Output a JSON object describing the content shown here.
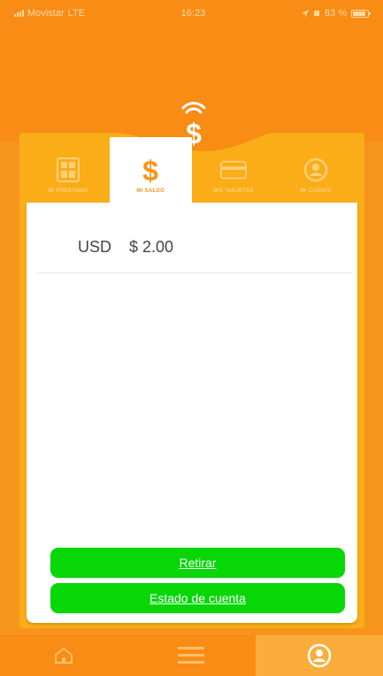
{
  "status_bar": {
    "carrier": "Movistar",
    "network": "LTE",
    "time": "16:23",
    "battery": "83 %"
  },
  "tabs": [
    {
      "label": "MI PRESTAMO",
      "icon": "calculator-icon",
      "active": false
    },
    {
      "label": "MI SALDO",
      "icon": "dollar-icon",
      "active": true
    },
    {
      "label": "MIS TARJETAS",
      "icon": "card-icon",
      "active": false
    },
    {
      "label": "MI CUENTA",
      "icon": "account-icon",
      "active": false
    }
  ],
  "balance": {
    "currency": "USD",
    "amount": "$ 2.00"
  },
  "buttons": {
    "withdraw": "Retirar",
    "statement": "Estado de cuenta"
  },
  "bottom_nav": [
    {
      "icon": "home-icon",
      "active": false
    },
    {
      "icon": "menu-icon",
      "active": false
    },
    {
      "icon": "profile-icon",
      "active": true
    }
  ],
  "colors": {
    "primary_orange": "#f88c14",
    "secondary_orange": "#fbad18",
    "button_green": "#07d607"
  }
}
